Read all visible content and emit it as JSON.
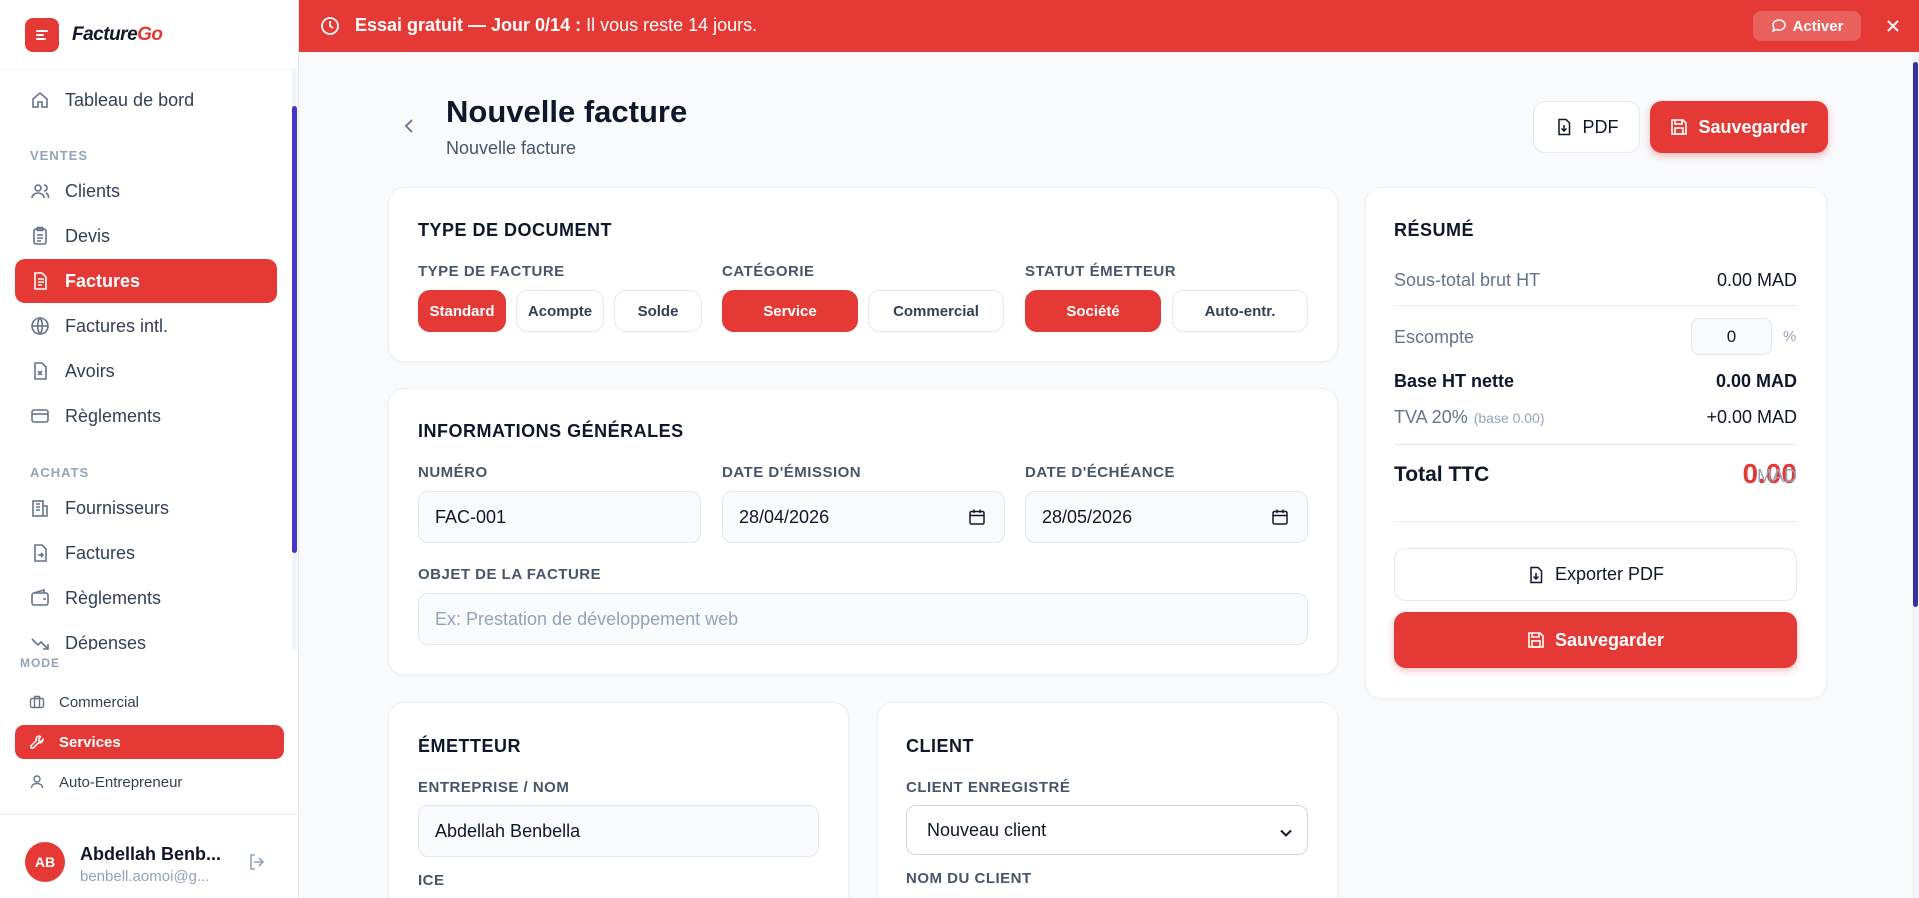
{
  "brand": {
    "name_main": "Facture",
    "name_accent": "Go"
  },
  "sidebar": {
    "dashboard": "Tableau de bord",
    "section_sales": "VENTES",
    "sales_items": [
      "Clients",
      "Devis",
      "Factures",
      "Factures intl.",
      "Avoirs",
      "Règlements"
    ],
    "section_purchases": "ACHATS",
    "purchase_items": [
      "Fournisseurs",
      "Factures",
      "Règlements",
      "Dépenses"
    ],
    "mode_label": "MODE",
    "mode_items": [
      "Commercial",
      "Services",
      "Auto-Entrepreneur"
    ],
    "user": {
      "initials": "AB",
      "name": "Abdellah Benb...",
      "email": "benbell.aomoi@g..."
    }
  },
  "banner": {
    "bold_text": "Essai gratuit — Jour 0/14 :",
    "text": " Il vous reste 14 jours.",
    "activate_label": "Activer"
  },
  "header": {
    "title": "Nouvelle facture",
    "subtitle": "Nouvelle facture",
    "pdf_label": "PDF",
    "save_label": "Sauvegarder"
  },
  "doc_type": {
    "title": "TYPE DE DOCUMENT",
    "invoice_type_label": "TYPE DE FACTURE",
    "invoice_types": [
      "Standard",
      "Acompte",
      "Solde"
    ],
    "category_label": "CATÉGORIE",
    "categories": [
      "Service",
      "Commercial"
    ],
    "issuer_status_label": "STATUT ÉMETTEUR",
    "issuer_statuses": [
      "Société",
      "Auto-entr."
    ]
  },
  "general": {
    "title": "INFORMATIONS GÉNÉRALES",
    "number_label": "NUMÉRO",
    "number_value": "FAC-001",
    "issue_date_label": "DATE D'ÉMISSION",
    "issue_date_value": "28/04/2026",
    "due_date_label": "DATE D'ÉCHÉANCE",
    "due_date_value": "28/05/2026",
    "object_label": "OBJET DE LA FACTURE",
    "object_placeholder": "Ex: Prestation de développement web"
  },
  "issuer": {
    "title": "ÉMETTEUR",
    "company_label": "ENTREPRISE / NOM",
    "company_value": "Abdellah Benbella",
    "ice_label": "ICE"
  },
  "client": {
    "title": "CLIENT",
    "saved_client_label": "CLIENT ENREGISTRÉ",
    "saved_client_value": "Nouveau client",
    "client_name_label": "NOM DU CLIENT"
  },
  "summary": {
    "title": "RÉSUMÉ",
    "subtotal_label": "Sous-total brut HT",
    "subtotal_value": "0.00 MAD",
    "discount_label": "Escompte",
    "discount_value": "0",
    "discount_unit": "%",
    "net_base_label": "Base HT nette",
    "net_base_value": "0.00 MAD",
    "vat_label": "TVA 20%",
    "vat_base": "(base 0.00)",
    "vat_value": "+0.00 MAD",
    "total_label": "Total TTC",
    "total_value": "0.00",
    "total_currency": "MAD",
    "export_label": "Exporter PDF",
    "save_label": "Sauvegarder"
  },
  "colors": {
    "accent": "#e53935",
    "scrollbar": "#4338ca"
  }
}
